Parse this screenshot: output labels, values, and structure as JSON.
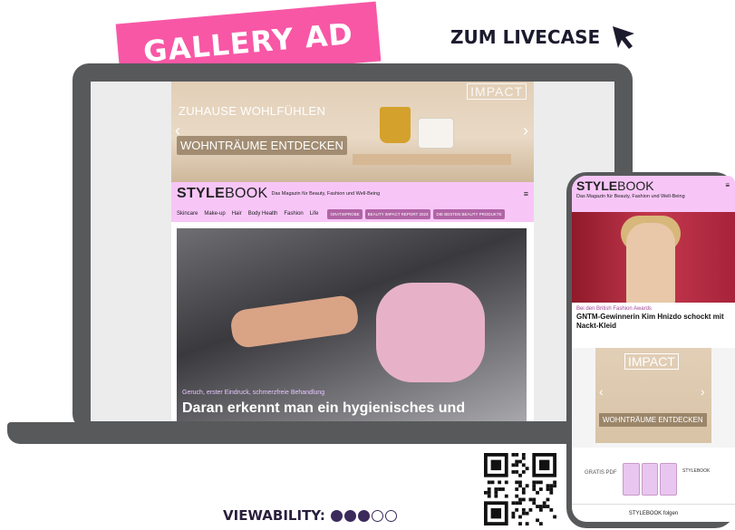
{
  "header": {
    "badge": "GALLERY AD",
    "livecase_label": "ZUM LIVECASE"
  },
  "laptop_site": {
    "ad": {
      "impact": "IMPACT",
      "line1": "ZUHAUSE WOHLFÜHLEN",
      "line2": "WOHNTRÄUME ENTDECKEN"
    },
    "logo_bold": "STYLE",
    "logo_thin": "BOOK",
    "tagline": "Das Magazin für Beauty, Fashion und Well-Being",
    "menu_icon": "≡",
    "nav": [
      "Skincare",
      "Make-up",
      "Hair",
      "Body Health",
      "Fashion",
      "Life"
    ],
    "pills": [
      "GRATISPROBE",
      "BEAUTY IMPACT REPORT 2023",
      "DIE BESTEN BEAUTY PRODUKTE"
    ],
    "article": {
      "kicker": "Geruch, erster Eindruck, schmerzfreie Behandlung",
      "headline": "Daran erkennt man ein hygienisches und"
    }
  },
  "phone_site": {
    "logo_bold": "STYLE",
    "logo_thin": "BOOK",
    "tagline": "Das Magazin für Beauty, Fashion und Well-Being",
    "menu_icon": "≡",
    "kicker": "Bei den British Fashion Awards",
    "headline": "GNTM-Gewinnerin Kim Hnizdo schockt mit Nackt-Kleid",
    "ad": {
      "impact": "IMPACT",
      "button": "WOHNTRÄUME ENTDECKEN"
    },
    "promo": {
      "label": "GRATIS PDF",
      "logo_bold": "STYLE",
      "logo_thin": "BOOK"
    },
    "footer": "STYLEBOOK folgen"
  },
  "viewability": {
    "label": "VIEWABILITY:",
    "filled": 3,
    "total": 5
  },
  "colors": {
    "badge": "#f857a6",
    "device": "#58595b",
    "header_pink": "#f7c6f7",
    "pill": "#b164a6",
    "dark_text": "#1c1b2e"
  }
}
